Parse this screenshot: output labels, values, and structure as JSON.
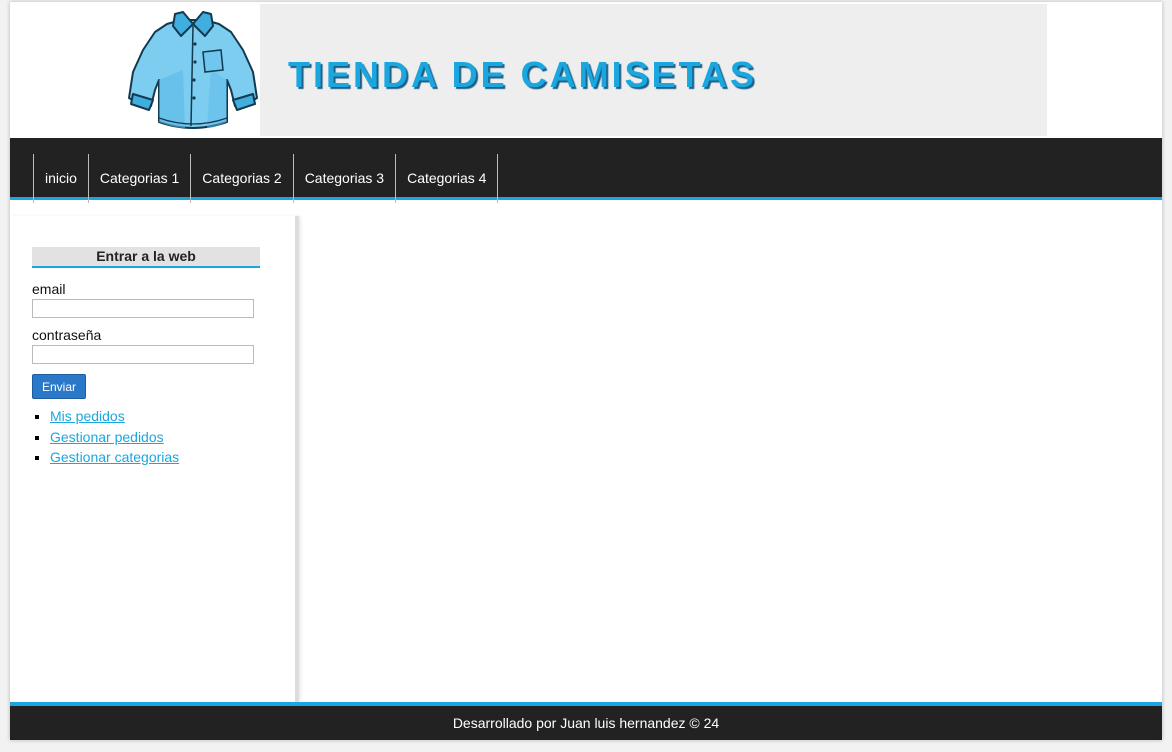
{
  "header": {
    "title": "TIENDA DE CAMISETAS",
    "logo_icon": "shirt-icon"
  },
  "nav": {
    "items": [
      {
        "label": "inicio"
      },
      {
        "label": "Categorias 1"
      },
      {
        "label": "Categorias 2"
      },
      {
        "label": "Categorias 3"
      },
      {
        "label": "Categorias 4"
      }
    ]
  },
  "sidebar": {
    "login_heading": "Entrar a la web",
    "email_label": "email",
    "email_value": "",
    "password_label": "contraseña",
    "password_value": "",
    "submit_label": "Enviar",
    "links": [
      {
        "label": "Mis pedidos"
      },
      {
        "label": "Gestionar pedidos"
      },
      {
        "label": "Gestionar categorias"
      }
    ]
  },
  "footer": {
    "text": "Desarrollado por Juan luis hernandez © 24"
  },
  "colors": {
    "accent": "#1aa7df",
    "nav_background": "#222222",
    "button": "#2a79c9"
  }
}
